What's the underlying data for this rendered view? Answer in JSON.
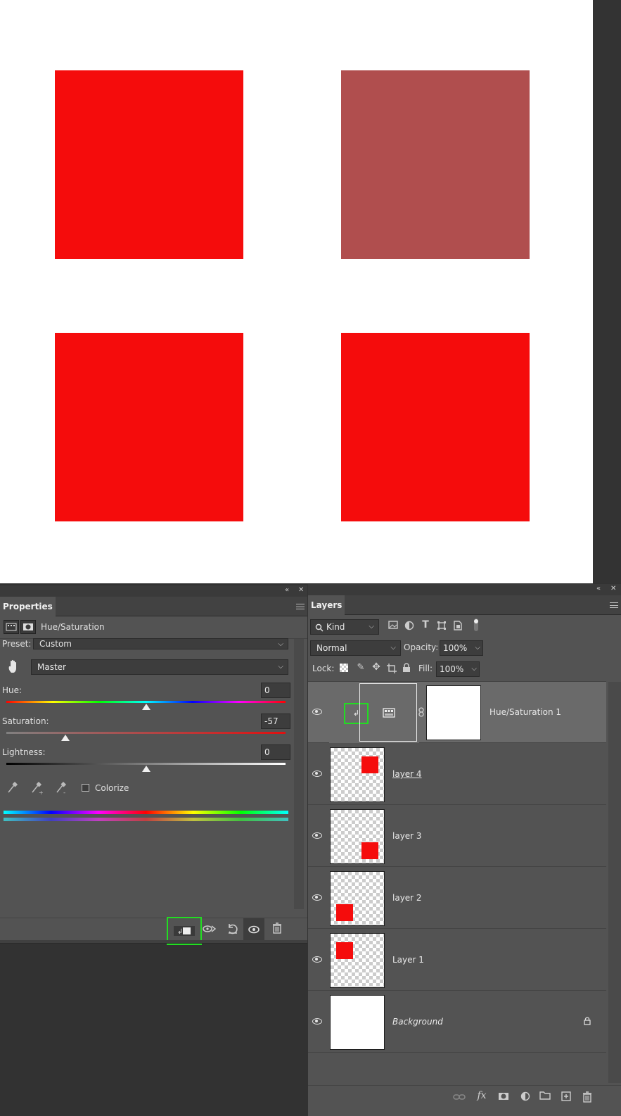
{
  "canvas": {
    "squares": [
      {
        "name": "top-left-square",
        "color": "#f50c0c"
      },
      {
        "name": "top-right-square",
        "color": "#b04e4e"
      },
      {
        "name": "bottom-left-square",
        "color": "#f50c0c"
      },
      {
        "name": "bottom-right-square",
        "color": "#f50c0c"
      }
    ]
  },
  "properties": {
    "tab": "Properties",
    "adjustment_title": "Hue/Saturation",
    "preset_label": "Preset:",
    "preset_value": "Custom",
    "channel_value": "Master",
    "hue_label": "Hue:",
    "hue_value": "0",
    "saturation_label": "Saturation:",
    "saturation_value": "-57",
    "lightness_label": "Lightness:",
    "lightness_value": "0",
    "colorize_label": "Colorize",
    "colorize_checked": false,
    "footer_icons": [
      "clip-to-layer-icon",
      "view-previous-icon",
      "reset-icon",
      "visibility-icon",
      "trash-icon"
    ]
  },
  "layers": {
    "tab": "Layers",
    "filter_kind": "Kind",
    "blend_mode": "Normal",
    "opacity_label": "Opacity:",
    "opacity_value": "100%",
    "lock_label": "Lock:",
    "fill_label": "Fill:",
    "fill_value": "100%",
    "items": [
      {
        "name": "Hue/Saturation 1",
        "selected": true
      },
      {
        "name": "layer 4",
        "selected": false
      },
      {
        "name": "layer 3",
        "selected": false
      },
      {
        "name": "layer 2",
        "selected": false
      },
      {
        "name": "Layer 1",
        "selected": false
      },
      {
        "name": "Background",
        "selected": false,
        "locked": true
      }
    ],
    "footer_icons": [
      "link-icon",
      "fx-icon",
      "mask-icon",
      "adjustment-icon",
      "folder-icon",
      "new-layer-icon",
      "trash-icon"
    ]
  },
  "colors": {
    "highlight": "#22dd22",
    "red": "#f50c0c",
    "desaturated_red": "#b04e4e"
  }
}
